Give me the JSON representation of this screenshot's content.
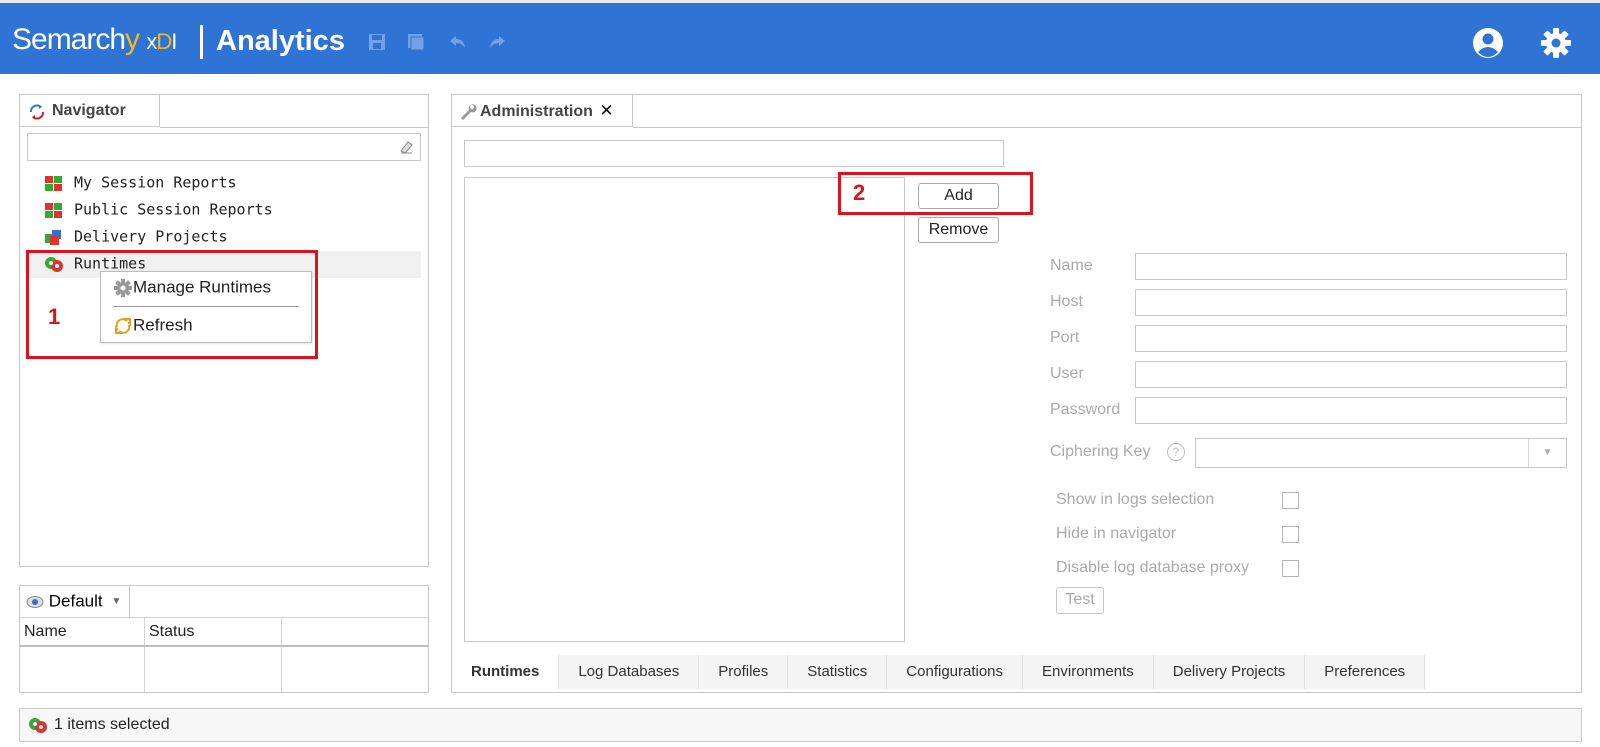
{
  "header": {
    "logo_main": "Semarch",
    "logo_y": "y",
    "logo_x": "x",
    "logo_d": "D",
    "logo_i": "I",
    "title": "Analytics",
    "toolbar_icons": [
      "save-icon",
      "save-all-icon",
      "undo-icon",
      "redo-icon"
    ],
    "right_icons": [
      "user-account-icon",
      "settings-gear-icon"
    ],
    "background": "#2f73d4"
  },
  "navigator": {
    "tab_label": "Navigator",
    "search_placeholder": "",
    "items": [
      {
        "label": "My Session Reports",
        "icon": "session-reports-icon"
      },
      {
        "label": "Public Session Reports",
        "icon": "session-reports-icon"
      },
      {
        "label": "Delivery Projects",
        "icon": "delivery-projects-icon"
      },
      {
        "label": "Runtimes",
        "icon": "runtimes-icon"
      }
    ],
    "context_menu": {
      "items": [
        {
          "label": "Manage Runtimes",
          "icon": "gear-icon"
        },
        {
          "label": "Refresh",
          "icon": "refresh-icon"
        }
      ]
    },
    "annotation": "1"
  },
  "properties": {
    "view_label": "Default",
    "columns": [
      "Name",
      "Status"
    ]
  },
  "administration": {
    "tab_label": "Administration",
    "search_value": "",
    "add_label": "Add",
    "remove_label": "Remove",
    "annotation": "2",
    "fields": [
      {
        "label": "Name",
        "value": ""
      },
      {
        "label": "Host",
        "value": ""
      },
      {
        "label": "Port",
        "value": ""
      },
      {
        "label": "User",
        "value": ""
      },
      {
        "label": "Password",
        "value": ""
      }
    ],
    "ciphering_key_label": "Ciphering Key",
    "ciphering_key_value": "",
    "checkboxes": [
      {
        "label": "Show in logs selection",
        "checked": false
      },
      {
        "label": "Hide in navigator",
        "checked": false
      },
      {
        "label": "Disable log database proxy",
        "checked": false
      }
    ],
    "test_label": "Test",
    "bottom_tabs": [
      "Runtimes",
      "Log Databases",
      "Profiles",
      "Statistics",
      "Configurations",
      "Environments",
      "Delivery Projects",
      "Preferences"
    ],
    "active_tab": "Runtimes"
  },
  "status_bar": {
    "text": "1 items selected",
    "icon": "runtimes-icon"
  },
  "colors": {
    "annotation_red": "#d8141e",
    "brand_blue": "#2f73d4",
    "logo_yellow": "#f5b71a"
  }
}
